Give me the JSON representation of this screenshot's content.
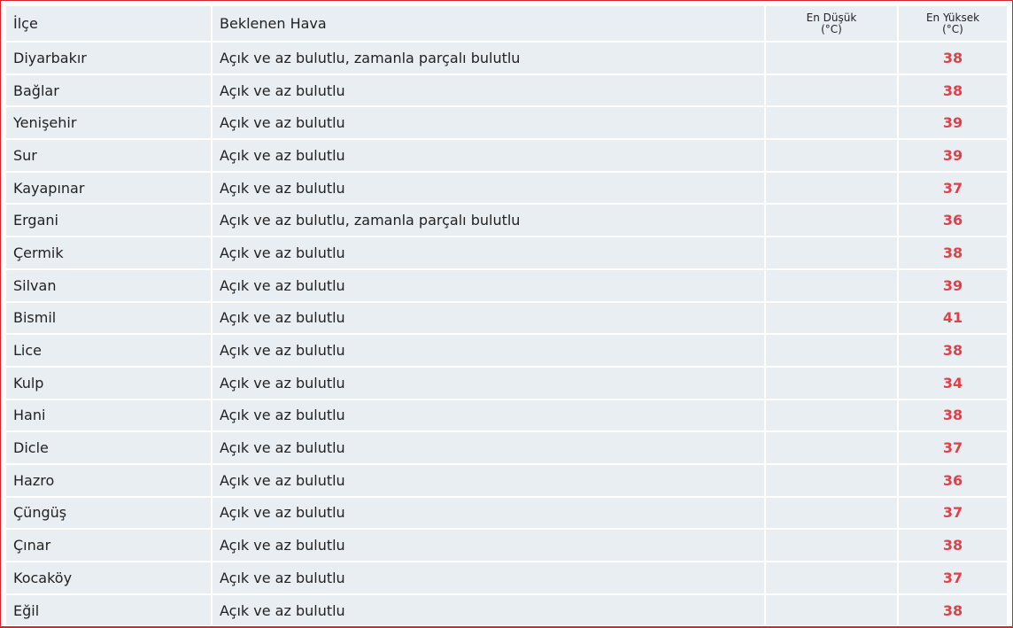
{
  "table": {
    "headers": {
      "district": "İlçe",
      "weather": "Beklenen Hava",
      "min_line1": "En Düşük",
      "min_line2": "(°C)",
      "max_line1": "En Yüksek",
      "max_line2": "(°C)"
    },
    "rows": [
      {
        "district": "Diyarbakır",
        "weather": "Açık ve az bulutlu, zamanla parçalı bulutlu",
        "min": "",
        "max": "38"
      },
      {
        "district": "Bağlar",
        "weather": "Açık ve az bulutlu",
        "min": "",
        "max": "38"
      },
      {
        "district": "Yenişehir",
        "weather": "Açık ve az bulutlu",
        "min": "",
        "max": "39"
      },
      {
        "district": "Sur",
        "weather": "Açık ve az bulutlu",
        "min": "",
        "max": "39"
      },
      {
        "district": "Kayapınar",
        "weather": "Açık ve az bulutlu",
        "min": "",
        "max": "37"
      },
      {
        "district": "Ergani",
        "weather": "Açık ve az bulutlu, zamanla parçalı bulutlu",
        "min": "",
        "max": "36"
      },
      {
        "district": "Çermik",
        "weather": "Açık ve az bulutlu",
        "min": "",
        "max": "38"
      },
      {
        "district": "Silvan",
        "weather": "Açık ve az bulutlu",
        "min": "",
        "max": "39"
      },
      {
        "district": "Bismil",
        "weather": "Açık ve az bulutlu",
        "min": "",
        "max": "41"
      },
      {
        "district": "Lice",
        "weather": "Açık ve az bulutlu",
        "min": "",
        "max": "38"
      },
      {
        "district": "Kulp",
        "weather": "Açık ve az bulutlu",
        "min": "",
        "max": "34"
      },
      {
        "district": "Hani",
        "weather": "Açık ve az bulutlu",
        "min": "",
        "max": "38"
      },
      {
        "district": "Dicle",
        "weather": "Açık ve az bulutlu",
        "min": "",
        "max": "37"
      },
      {
        "district": "Hazro",
        "weather": "Açık ve az bulutlu",
        "min": "",
        "max": "36"
      },
      {
        "district": "Çüngüş",
        "weather": "Açık ve az bulutlu",
        "min": "",
        "max": "37"
      },
      {
        "district": "Çınar",
        "weather": "Açık ve az bulutlu",
        "min": "",
        "max": "38"
      },
      {
        "district": "Kocaköy",
        "weather": "Açık ve az bulutlu",
        "min": "",
        "max": "37"
      },
      {
        "district": "Eğil",
        "weather": "Açık ve az bulutlu",
        "min": "",
        "max": "38"
      }
    ]
  },
  "colors": {
    "frame_border": "#d8262e",
    "cell_background": "#e9eef2",
    "max_temp_text": "#e0404a",
    "text": "#222222"
  }
}
